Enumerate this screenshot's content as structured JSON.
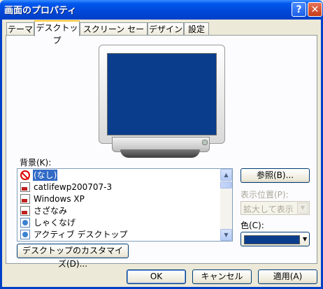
{
  "window": {
    "title": "画面のプロパティ",
    "help": "?",
    "close": "✕"
  },
  "tabs": [
    "テーマ",
    "デスクトップ",
    "スクリーン セーバー",
    "デザイン",
    "設定"
  ],
  "background": {
    "label": "背景(K):",
    "items": [
      {
        "text": "(なし)",
        "icon": "no-entry-icon",
        "selected": true
      },
      {
        "text": "catlifewp200707-3",
        "icon": "image-file-icon"
      },
      {
        "text": "Windows XP",
        "icon": "image-file-icon"
      },
      {
        "text": "さざなみ",
        "icon": "image-file-icon"
      },
      {
        "text": "しゃくなげ",
        "icon": "html-file-icon"
      },
      {
        "text": "アクティブ デスクトップ",
        "icon": "html-file-icon"
      }
    ]
  },
  "buttons": {
    "browse": "参照(B)...",
    "customize": "デスクトップのカスタマイズ(D)...",
    "ok": "OK",
    "cancel": "キャンセル",
    "apply": "適用(A)"
  },
  "position": {
    "label": "表示位置(P):",
    "value": "拡大して表示"
  },
  "color": {
    "label": "色(C):",
    "value": "#0a3e8c"
  },
  "colors": {
    "title_bar": "#0054e3",
    "selection": "#316ac5",
    "desktop_preview": "#0a3e8c"
  }
}
